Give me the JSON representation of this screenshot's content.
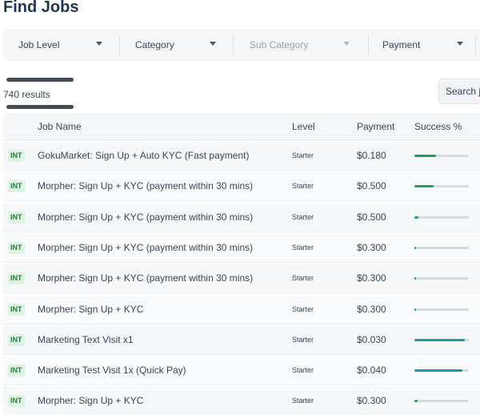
{
  "page": {
    "title": "Find Jobs"
  },
  "filters": [
    {
      "label": "Job Level",
      "disabled": false
    },
    {
      "label": "Category",
      "disabled": false
    },
    {
      "label": "Sub Category",
      "disabled": true
    },
    {
      "label": "Payment",
      "disabled": false
    }
  ],
  "results": {
    "count_text": "740 results"
  },
  "search": {
    "placeholder": "Search jobs"
  },
  "table": {
    "columns": [
      "Job Name",
      "Level",
      "Payment",
      "Success %"
    ],
    "rows": [
      {
        "badge": "INT",
        "name": "GokuMarket: Sign Up + Auto KYC (Fast payment)",
        "level": "Starter",
        "payment": "$0.180",
        "success": 0.4,
        "success_color": "#1e9e5a"
      },
      {
        "badge": "INT",
        "name": "Morpher: Sign Up + KYC (payment within 30 mins)",
        "level": "Starter",
        "payment": "$0.500",
        "success": 0.35,
        "success_color": "#1e9e5a"
      },
      {
        "badge": "INT",
        "name": "Morpher: Sign Up + KYC (payment within 30 mins)",
        "level": "Starter",
        "payment": "$0.500",
        "success": 0.08,
        "success_color": "#1e9e5a"
      },
      {
        "badge": "INT",
        "name": "Morpher: Sign Up + KYC (payment within 30 mins)",
        "level": "Starter",
        "payment": "$0.300",
        "success": 0.02,
        "success_color": "#1a9aa8"
      },
      {
        "badge": "INT",
        "name": "Morpher: Sign Up + KYC (payment within 30 mins)",
        "level": "Starter",
        "payment": "$0.300",
        "success": 0.01,
        "success_color": "#1a9aa8"
      },
      {
        "badge": "INT",
        "name": "Morpher: Sign Up + KYC",
        "level": "Starter",
        "payment": "$0.300",
        "success": 0.01,
        "success_color": "#1a9aa8"
      },
      {
        "badge": "INT",
        "name": "Marketing Text Visit x1",
        "level": "Starter",
        "payment": "$0.030",
        "success": 0.92,
        "success_color": "#1a9aa8"
      },
      {
        "badge": "INT",
        "name": "Marketing Test Visit 1x (Quick Pay)",
        "level": "Starter",
        "payment": "$0.040",
        "success": 0.88,
        "success_color": "#1a9aa8"
      },
      {
        "badge": "INT",
        "name": "Morpher: Sign Up + KYC",
        "level": "Starter",
        "payment": "$0.300",
        "success": 0.06,
        "success_color": "#1e9e5a"
      }
    ]
  }
}
